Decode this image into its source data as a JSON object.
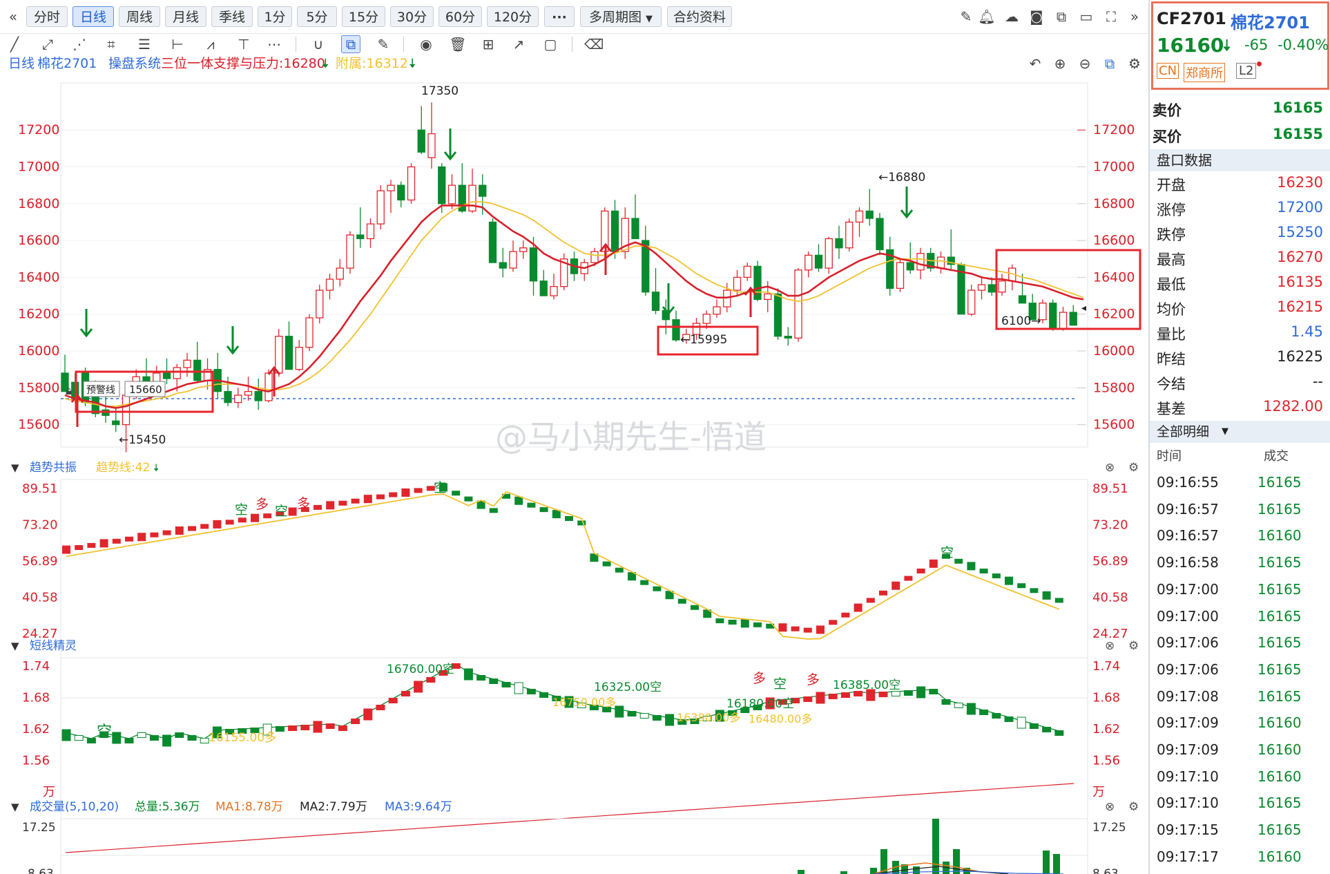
{
  "toolbar": {
    "periods": [
      "分时",
      "日线",
      "周线",
      "月线",
      "季线",
      "1分",
      "5分",
      "15分",
      "30分",
      "60分",
      "120分"
    ],
    "active_period": "日线",
    "more": "···",
    "multi_period": "多周期图",
    "contract_info": "合约资料"
  },
  "info": {
    "period": "日线",
    "name": "棉花2701",
    "system": "操盘系统",
    "indicator_label": "三位一体支撑与压力:16280",
    "attach_label": "附属:16312"
  },
  "colors": {
    "up": "#e0262c",
    "down": "#0a8a2e",
    "ma_red": "#d8202a",
    "ma_yellow": "#f2c12e",
    "highlight": "#e8252c",
    "blue": "#2f6bd8"
  },
  "main_chart": {
    "y_ticks": [
      "17200",
      "17000",
      "16800",
      "16600",
      "16400",
      "16200",
      "16000",
      "15800",
      "15600"
    ],
    "annotations": {
      "high": "17350",
      "peak2": "←16880",
      "low_mid": "←15995",
      "low_left": "←15450",
      "right": "6100→",
      "warning": "预警线",
      "warning_value": "15660"
    }
  },
  "chart_data": {
    "type": "candlestick",
    "y_range": [
      15450,
      17350
    ],
    "ohlc": [
      [
        15880,
        15980,
        15780,
        15780
      ],
      [
        15830,
        15880,
        15720,
        15740
      ],
      [
        15880,
        15910,
        15700,
        15720
      ],
      [
        15760,
        15840,
        15640,
        15660
      ],
      [
        15680,
        15780,
        15610,
        15650
      ],
      [
        15620,
        15700,
        15560,
        15600
      ],
      [
        15600,
        15780,
        15450,
        15760
      ],
      [
        15760,
        15900,
        15740,
        15860
      ],
      [
        15860,
        15960,
        15760,
        15800
      ],
      [
        15800,
        15920,
        15770,
        15880
      ],
      [
        15880,
        15960,
        15820,
        15850
      ],
      [
        15850,
        15930,
        15780,
        15910
      ],
      [
        15910,
        15990,
        15860,
        15950
      ],
      [
        15950,
        16050,
        15830,
        15840
      ],
      [
        15840,
        15960,
        15790,
        15900
      ],
      [
        15900,
        15990,
        15740,
        15780
      ],
      [
        15780,
        15860,
        15700,
        15720
      ],
      [
        15720,
        15800,
        15690,
        15760
      ],
      [
        15760,
        15860,
        15730,
        15780
      ],
      [
        15780,
        15850,
        15680,
        15730
      ],
      [
        15730,
        15900,
        15720,
        15880
      ],
      [
        15880,
        16120,
        15860,
        16080
      ],
      [
        16080,
        16160,
        15900,
        15900
      ],
      [
        15900,
        16060,
        15890,
        16020
      ],
      [
        16020,
        16200,
        16000,
        16180
      ],
      [
        16180,
        16360,
        16150,
        16330
      ],
      [
        16330,
        16420,
        16280,
        16390
      ],
      [
        16390,
        16500,
        16350,
        16450
      ],
      [
        16450,
        16650,
        16420,
        16630
      ],
      [
        16630,
        16780,
        16560,
        16610
      ],
      [
        16610,
        16720,
        16560,
        16690
      ],
      [
        16690,
        16900,
        16660,
        16870
      ],
      [
        16870,
        16930,
        16750,
        16900
      ],
      [
        16900,
        16920,
        16780,
        16820
      ],
      [
        16820,
        17020,
        16800,
        17000
      ],
      [
        17200,
        17330,
        17070,
        17080
      ],
      [
        17050,
        17350,
        16990,
        17180
      ],
      [
        17000,
        17020,
        16750,
        16800
      ],
      [
        16800,
        16960,
        16770,
        16900
      ],
      [
        16900,
        17020,
        16750,
        16760
      ],
      [
        16760,
        16990,
        16750,
        16900
      ],
      [
        16900,
        16960,
        16740,
        16840
      ],
      [
        16700,
        16720,
        16480,
        16480
      ],
      [
        16480,
        16560,
        16400,
        16450
      ],
      [
        16450,
        16600,
        16430,
        16540
      ],
      [
        16540,
        16600,
        16500,
        16560
      ],
      [
        16560,
        16620,
        16300,
        16380
      ],
      [
        16380,
        16440,
        16300,
        16300
      ],
      [
        16300,
        16420,
        16280,
        16350
      ],
      [
        16350,
        16530,
        16330,
        16500
      ],
      [
        16500,
        16540,
        16380,
        16420
      ],
      [
        16420,
        16500,
        16380,
        16480
      ],
      [
        16480,
        16560,
        16460,
        16540
      ],
      [
        16540,
        16780,
        16500,
        16760
      ],
      [
        16760,
        16820,
        16500,
        16540
      ],
      [
        16540,
        16780,
        16500,
        16720
      ],
      [
        16720,
        16850,
        16610,
        16610
      ],
      [
        16600,
        16680,
        16300,
        16320
      ],
      [
        16320,
        16450,
        16200,
        16220
      ],
      [
        16220,
        16280,
        16090,
        16170
      ],
      [
        16170,
        16220,
        16050,
        16060
      ],
      [
        16060,
        16120,
        16040,
        16090
      ],
      [
        16090,
        16180,
        16060,
        16150
      ],
      [
        16150,
        16220,
        16120,
        16200
      ],
      [
        16200,
        16280,
        16180,
        16240
      ],
      [
        16240,
        16370,
        16210,
        16330
      ],
      [
        16330,
        16440,
        16300,
        16400
      ],
      [
        16400,
        16480,
        16380,
        16460
      ],
      [
        16460,
        16490,
        16270,
        16280
      ],
      [
        16280,
        16380,
        16210,
        16310
      ],
      [
        16310,
        16340,
        16060,
        16080
      ],
      [
        16080,
        16130,
        16030,
        16070
      ],
      [
        16070,
        16450,
        16050,
        16440
      ],
      [
        16440,
        16540,
        16400,
        16520
      ],
      [
        16520,
        16580,
        16430,
        16450
      ],
      [
        16450,
        16620,
        16420,
        16610
      ],
      [
        16610,
        16680,
        16500,
        16560
      ],
      [
        16560,
        16720,
        16540,
        16700
      ],
      [
        16700,
        16780,
        16620,
        16760
      ],
      [
        16760,
        16880,
        16680,
        16720
      ],
      [
        16720,
        16750,
        16520,
        16550
      ],
      [
        16550,
        16620,
        16300,
        16340
      ],
      [
        16340,
        16500,
        16320,
        16480
      ],
      [
        16480,
        16590,
        16420,
        16440
      ],
      [
        16440,
        16560,
        16390,
        16530
      ],
      [
        16530,
        16560,
        16430,
        16450
      ],
      [
        16450,
        16540,
        16420,
        16510
      ],
      [
        16510,
        16660,
        16440,
        16470
      ],
      [
        16470,
        16480,
        16280,
        16200
      ],
      [
        16200,
        16360,
        16190,
        16330
      ],
      [
        16330,
        16400,
        16280,
        16360
      ],
      [
        16360,
        16400,
        16300,
        16320
      ],
      [
        16320,
        16420,
        16300,
        16380
      ],
      [
        16380,
        16470,
        16330,
        16450
      ],
      [
        16300,
        16420,
        16280,
        16260
      ],
      [
        16260,
        16310,
        16170,
        16170
      ],
      [
        16170,
        16280,
        16150,
        16260
      ],
      [
        16260,
        16280,
        16110,
        16120
      ],
      [
        16120,
        16240,
        16110,
        16210
      ],
      [
        16210,
        16250,
        16150,
        16140
      ]
    ],
    "ma_red": [
      15760,
      15740,
      15730,
      15720,
      15700,
      15690,
      15700,
      15720,
      15740,
      15760,
      15780,
      15800,
      15820,
      15830,
      15840,
      15840,
      15830,
      15820,
      15810,
      15790,
      15780,
      15800,
      15820,
      15860,
      15910,
      15970,
      16040,
      16110,
      16190,
      16270,
      16340,
      16410,
      16490,
      16560,
      16630,
      16700,
      16750,
      16790,
      16790,
      16790,
      16790,
      16780,
      16730,
      16690,
      16650,
      16620,
      16580,
      16530,
      16500,
      16480,
      16460,
      16450,
      16470,
      16500,
      16540,
      16570,
      16590,
      16570,
      16530,
      16480,
      16430,
      16380,
      16340,
      16310,
      16290,
      16290,
      16300,
      16320,
      16340,
      16350,
      16330,
      16300,
      16300,
      16320,
      16360,
      16400,
      16430,
      16460,
      16490,
      16510,
      16530,
      16520,
      16500,
      16490,
      16470,
      16460,
      16450,
      16440,
      16430,
      16420,
      16400,
      16390,
      16390,
      16380,
      16370,
      16360,
      16350,
      16330,
      16310,
      16290,
      16280
    ],
    "ma_yellow": [
      15740,
      15730,
      15720,
      15710,
      15700,
      15700,
      15710,
      15720,
      15730,
      15740,
      15750,
      15770,
      15780,
      15800,
      15810,
      15820,
      15820,
      15820,
      15810,
      15800,
      15790,
      15790,
      15800,
      15820,
      15850,
      15890,
      15940,
      16000,
      16060,
      16130,
      16200,
      16280,
      16360,
      16440,
      16520,
      16600,
      16660,
      16720,
      16760,
      16790,
      16810,
      16810,
      16800,
      16780,
      16760,
      16740,
      16710,
      16670,
      16630,
      16590,
      16560,
      16530,
      16520,
      16520,
      16530,
      16550,
      16570,
      16570,
      16560,
      16530,
      16500,
      16460,
      16420,
      16390,
      16360,
      16340,
      16320,
      16320,
      16320,
      16320,
      16300,
      16280,
      16270,
      16280,
      16300,
      16330,
      16360,
      16390,
      16420,
      16450,
      16470,
      16490,
      16500,
      16500,
      16500,
      16490,
      16490,
      16480,
      16470,
      16460,
      16450,
      16440,
      16430,
      16420,
      16400,
      16390,
      16370,
      16350,
      16330,
      16310,
      16290
    ]
  },
  "trend_panel": {
    "title": "趋势共振",
    "sub": "趋势线:42",
    "ticks": [
      "89.51",
      "73.20",
      "56.89",
      "40.58",
      "24.27"
    ],
    "labels": [
      "空",
      "多",
      "空",
      "多",
      "空",
      "多",
      "空",
      "多",
      "空"
    ]
  },
  "short_panel": {
    "title": "短线精灵",
    "ticks": [
      "1.74",
      "1.68",
      "1.62",
      "1.56",
      "万"
    ],
    "labels": [
      "16760.00空",
      "16325.00空",
      "16385.00空",
      "16180.00空",
      "16155.00多",
      "16750.00多",
      "16380.00多",
      "16480.00多",
      "空"
    ]
  },
  "volume_panel": {
    "title": "成交量(5,10,20)",
    "total": "总量:5.36万",
    "ma1": "MA1:8.78万",
    "ma2": "MA2:7.79万",
    "ma3": "MA3:9.64万",
    "ticks": [
      "17.25",
      "8.63"
    ]
  },
  "watermark": "@马小期先生-悟道",
  "quote": {
    "code": "CF2701",
    "name": "棉花2701",
    "price": "16160",
    "change": "-65",
    "change_pct": "-0.40%",
    "tags": [
      "CN",
      "郑商所",
      "L2"
    ]
  },
  "book": {
    "ask_label": "卖价",
    "ask": "16165",
    "bid_label": "买价",
    "bid": "16155"
  },
  "market_data": {
    "title": "盘口数据",
    "rows": [
      {
        "k": "开盘",
        "v": "16230",
        "c": "red"
      },
      {
        "k": "涨停",
        "v": "17200",
        "c": "blue"
      },
      {
        "k": "跌停",
        "v": "15250",
        "c": "blue"
      },
      {
        "k": "最高",
        "v": "16270",
        "c": "red"
      },
      {
        "k": "最低",
        "v": "16135",
        "c": "red"
      },
      {
        "k": "均价",
        "v": "16215",
        "c": "red"
      },
      {
        "k": "量比",
        "v": "1.45",
        "c": "blue"
      },
      {
        "k": "昨结",
        "v": "16225",
        "c": "black"
      },
      {
        "k": "今结",
        "v": "--",
        "c": "black"
      },
      {
        "k": "基差",
        "v": "1282.00",
        "c": "red"
      }
    ]
  },
  "ticks": {
    "title": "全部明细",
    "col_time": "时间",
    "col_price": "成交",
    "rows": [
      {
        "t": "09:16:55",
        "p": "16165"
      },
      {
        "t": "09:16:57",
        "p": "16165"
      },
      {
        "t": "09:16:57",
        "p": "16160"
      },
      {
        "t": "09:16:58",
        "p": "16165"
      },
      {
        "t": "09:17:00",
        "p": "16165"
      },
      {
        "t": "09:17:00",
        "p": "16165"
      },
      {
        "t": "09:17:06",
        "p": "16165"
      },
      {
        "t": "09:17:06",
        "p": "16165"
      },
      {
        "t": "09:17:08",
        "p": "16165"
      },
      {
        "t": "09:17:09",
        "p": "16160"
      },
      {
        "t": "09:17:09",
        "p": "16160"
      },
      {
        "t": "09:17:10",
        "p": "16160"
      },
      {
        "t": "09:17:10",
        "p": "16165"
      },
      {
        "t": "09:17:15",
        "p": "16165"
      },
      {
        "t": "09:17:17",
        "p": "16160"
      }
    ]
  }
}
